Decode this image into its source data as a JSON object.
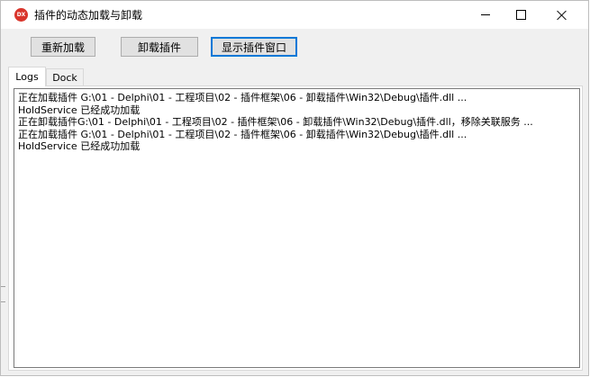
{
  "window": {
    "title": "插件的动态加载与卸载",
    "icon_text": "DX",
    "icon_color": "#d9342b"
  },
  "toolbar": {
    "reload_label": "重新加载",
    "unload_label": "卸载插件",
    "show_window_label": "显示插件窗口"
  },
  "tabs": [
    {
      "label": "Logs",
      "active": true
    },
    {
      "label": "Dock",
      "active": false
    }
  ],
  "logs": [
    "正在加载插件 G:\\01 - Delphi\\01 - 工程项目\\02 - 插件框架\\06 - 卸载插件\\Win32\\Debug\\插件.dll ...",
    "HoldService 已经成功加载",
    "正在卸载插件G:\\01 - Delphi\\01 - 工程项目\\02 - 插件框架\\06 - 卸载插件\\Win32\\Debug\\插件.dll，移除关联服务 ...",
    "正在加载插件 G:\\01 - Delphi\\01 - 工程项目\\02 - 插件框架\\06 - 卸载插件\\Win32\\Debug\\插件.dll ...",
    "HoldService 已经成功加载"
  ],
  "colors": {
    "focus_border": "#0078d7",
    "button_face": "#e1e1e1",
    "window_bg": "#f0f0f0"
  }
}
